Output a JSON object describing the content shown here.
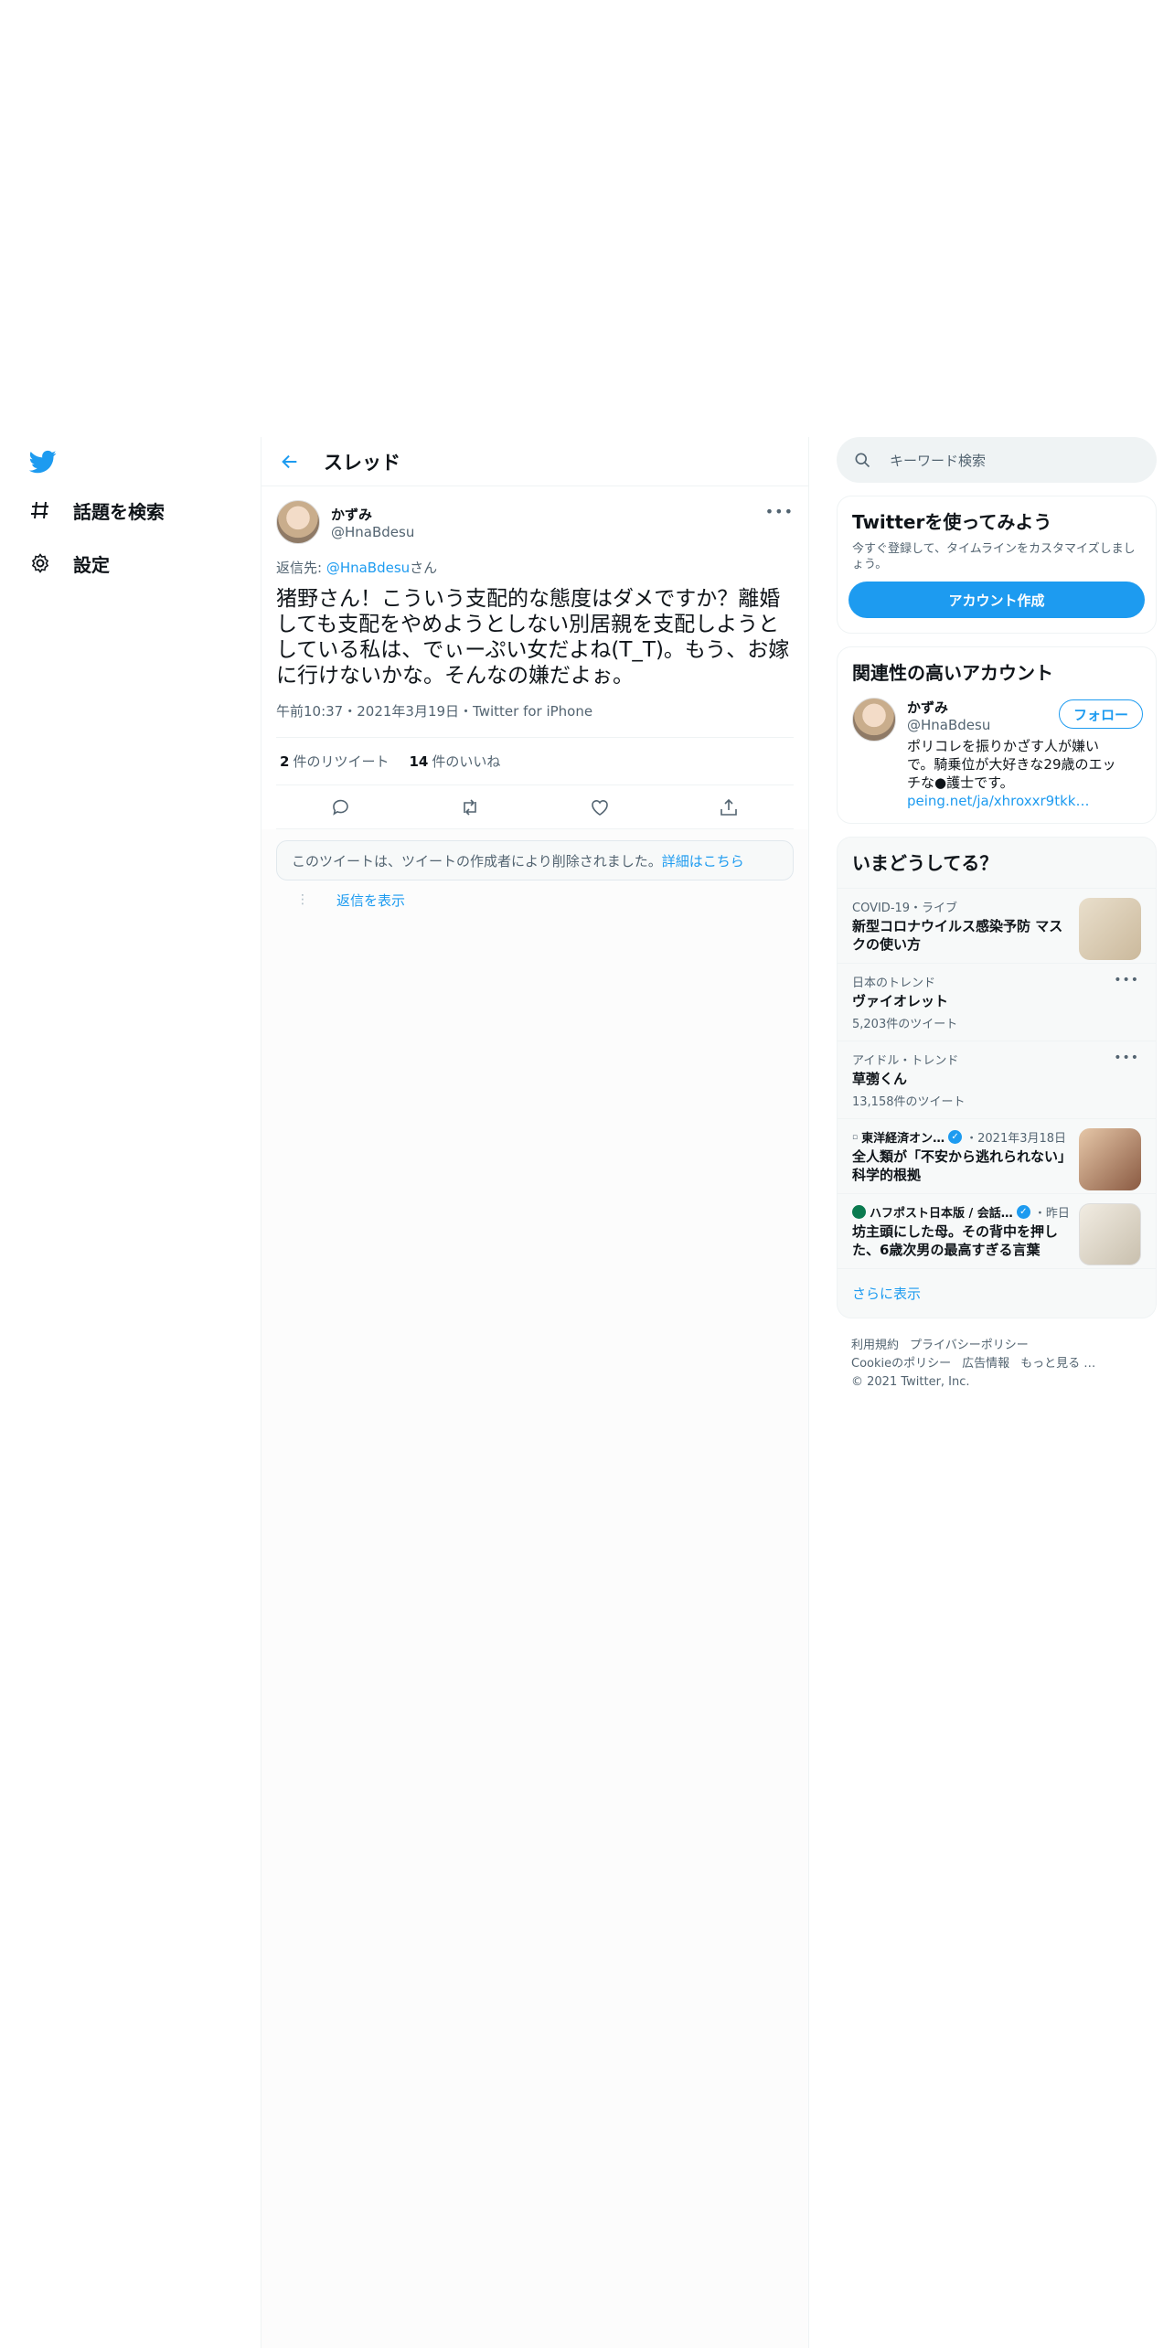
{
  "nav": {
    "items": [
      {
        "label": "話題を検索",
        "icon": "hashtag-icon"
      },
      {
        "label": "設定",
        "icon": "gear-icon"
      }
    ]
  },
  "thread": {
    "title": "スレッド",
    "tweet": {
      "name": "かずみ",
      "handle": "@HnaBdesu",
      "reply_prefix": "返信先: ",
      "reply_to": "@HnaBdesu",
      "reply_suffix": "さん",
      "text": "猪野さん！こういう支配的な態度はダメですか？離婚しても支配をやめようとしない別居親を支配しようとしている私は、でぃーぷい女だよね(T_T)。もう、お嫁に行けないかな。そんなの嫌だよぉ。",
      "meta": "午前10:37・2021年3月19日・Twitter for iPhone",
      "retweets_count": "2",
      "retweets_label": "件のリツイート",
      "likes_count": "14",
      "likes_label": "件のいいね"
    },
    "deleted_notice": "このツイートは、ツイートの作成者により削除されました。",
    "deleted_link": "詳細はこちら",
    "show_replies": "返信を表示"
  },
  "search": {
    "placeholder": "キーワード検索"
  },
  "signup": {
    "title": "Twitterを使ってみよう",
    "desc": "今すぐ登録して、タイムラインをカスタマイズしましょう。",
    "button": "アカウント作成"
  },
  "related": {
    "title": "関連性の高いアカウント",
    "name": "かずみ",
    "handle": "@HnaBdesu",
    "bio": "ポリコレを振りかざす人が嫌いで。騎乗位が大好きな29歳のエッチな●護士です。",
    "bio_link": "peing.net/ja/xhroxxr9tkk…",
    "follow": "フォロー"
  },
  "trends": {
    "title": "いまどうしてる？",
    "items": [
      {
        "meta": "COVID-19・ライブ",
        "title": "新型コロナウイルス感染予防 マスクの使い方",
        "thumb": "#d9cbb3"
      },
      {
        "meta": "日本のトレンド",
        "title": "ヴァイオレット",
        "count": "5,203件のツイート"
      },
      {
        "meta": "アイドル・トレンド",
        "title": "草彅くん",
        "count": "13,158件のツイート"
      },
      {
        "source": "東洋経済オン…",
        "when": "・2021年3月18日",
        "title": "全人類が「不安から逃れられない」科学的根拠",
        "thumb": "#b9876a"
      },
      {
        "source": "ハフポスト日本版 / 会話…",
        "when": "・昨日",
        "title": "坊主頭にした母。その背中を押した、6歳次男の最高すぎる言葉",
        "thumb": "#e8e1d4"
      }
    ],
    "show_more": "さらに表示"
  },
  "footer": {
    "links1": [
      "利用規約",
      "プライバシーポリシー"
    ],
    "links2": [
      "Cookieのポリシー",
      "広告情報",
      "もっと見る …"
    ],
    "copyright": "© 2021 Twitter, Inc."
  },
  "colors": {
    "accent": "#1d9bf0",
    "text": "#0f1419",
    "muted": "#536471"
  }
}
